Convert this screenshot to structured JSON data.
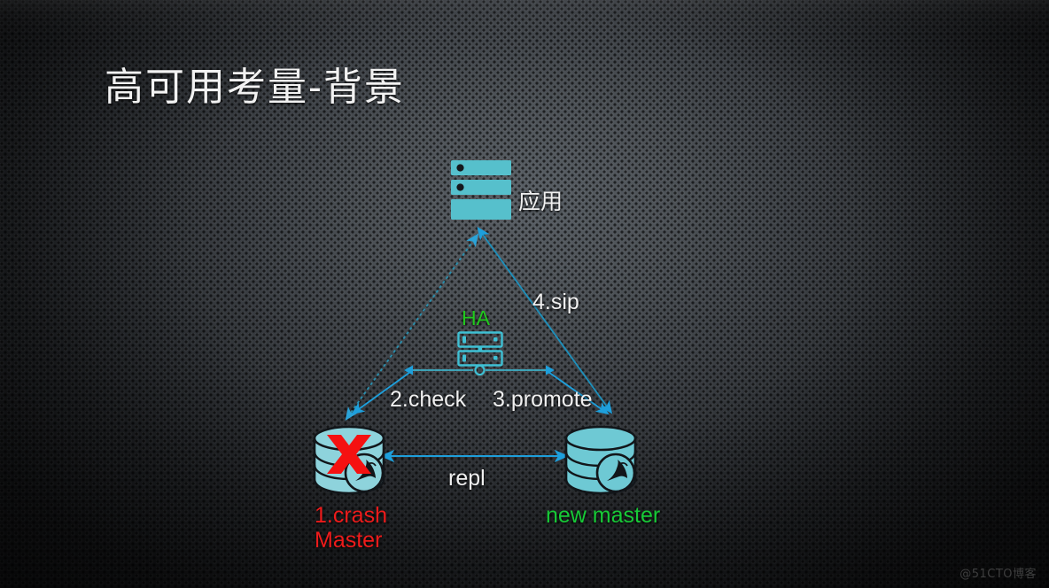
{
  "slide": {
    "title": "高可用考量-背景",
    "watermark": "@51CTO博客",
    "accent_teal": "#56c0cc",
    "accent_arrow_blue": "#1e9fdb",
    "accent_green": "#22c81f",
    "accent_red": "#ee1b1b",
    "background_color": "#2c2f33"
  },
  "nodes": {
    "app": {
      "label": "应用",
      "icon": "server-stack-icon"
    },
    "ha": {
      "label": "HA",
      "icon": "server-rack-outline-icon",
      "color": "#22c81f"
    },
    "crash_master": {
      "label_line1": "1.crash",
      "label_line2": "Master",
      "icon": "database-cylinder-icon",
      "overlay_icon": "red-x-icon",
      "badge_icon": "mysql-dolphin-icon",
      "color": "#ee1b1b"
    },
    "new_master": {
      "label": "new master",
      "icon": "database-cylinder-icon",
      "badge_icon": "mysql-dolphin-icon",
      "color": "#17ca37"
    }
  },
  "edges": [
    {
      "id": "crash-to-app",
      "label": "",
      "style": "dashed",
      "direction": "both"
    },
    {
      "id": "app-to-new",
      "label": "4.sip",
      "style": "solid",
      "direction": "both"
    },
    {
      "id": "ha-to-crash",
      "label": "2.check",
      "style": "solid",
      "direction": "to-crash"
    },
    {
      "id": "ha-to-new",
      "label": "3.promote",
      "style": "solid",
      "direction": "to-new"
    },
    {
      "id": "replication",
      "label": "repl",
      "style": "solid",
      "direction": "both"
    }
  ]
}
